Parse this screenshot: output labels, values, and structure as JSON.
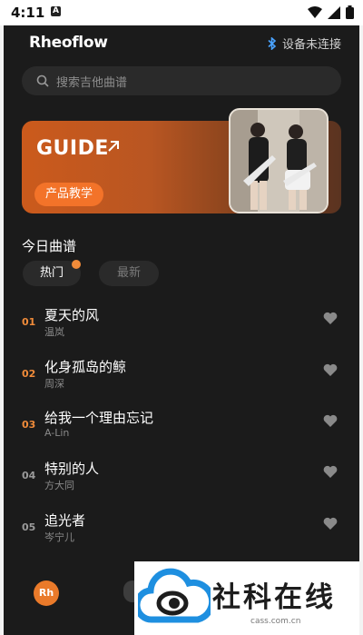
{
  "statusbar": {
    "time": "4:11"
  },
  "header": {
    "logo": "Rheoflow",
    "device": "设备未连接"
  },
  "search": {
    "placeholder": "搜索吉他曲谱"
  },
  "banner": {
    "title": "GUIDE",
    "button": "产品教学"
  },
  "section": {
    "title": "今日曲谱"
  },
  "tabs": {
    "hot": "热门",
    "new": "最新"
  },
  "songs": [
    {
      "num": "01",
      "title": "夏天的风",
      "artist": "温岚"
    },
    {
      "num": "02",
      "title": "化身孤岛的鲸",
      "artist": "周深"
    },
    {
      "num": "03",
      "title": "给我一个理由忘记",
      "artist": "A-Lin"
    },
    {
      "num": "04",
      "title": "特别的人",
      "artist": "方大同"
    },
    {
      "num": "05",
      "title": "追光者",
      "artist": "岑宁儿"
    }
  ],
  "bottom": {
    "avatar": "Rh"
  },
  "watermark": {
    "text": "社科在线",
    "url": "cass.com.cn"
  },
  "colors": {
    "accent": "#f37329",
    "top3": "#f08b3a",
    "rest": "#9a9a9a"
  }
}
